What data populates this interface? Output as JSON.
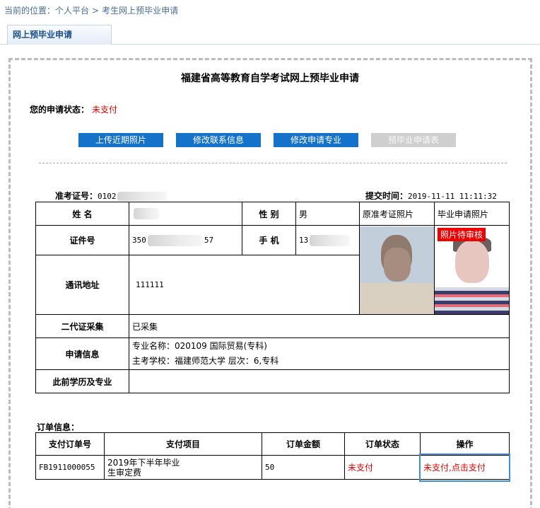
{
  "breadcrumb": {
    "prefix": "当前的位置：",
    "items": [
      "个人平台",
      "考生网上预毕业申请"
    ],
    "separator": ">"
  },
  "tab": {
    "label": "网上预毕业申请"
  },
  "page_title": "福建省高等教育自学考试网上预毕业申请",
  "status": {
    "label": "您的申请状态：",
    "value": "未支付"
  },
  "buttons": [
    {
      "label": "上传近期照片",
      "enabled": true
    },
    {
      "label": "修改联系信息",
      "enabled": true
    },
    {
      "label": "修改申请专业",
      "enabled": true
    },
    {
      "label": "预毕业申请表",
      "enabled": false
    }
  ],
  "meta": {
    "exam_no_label": "准考证号：",
    "exam_no_value": "0102",
    "submit_time_label": "提交时间：",
    "submit_time_value": "2019-11-11 11:11:32"
  },
  "info": {
    "name_label": "姓 名",
    "name_value": "",
    "gender_label": "性 别",
    "gender_value": "男",
    "orig_photo_label": "原准考证照片",
    "grad_photo_label": "毕业申请照片",
    "photo_pending": "照片待审核",
    "id_label": "证件号",
    "id_prefix": "350",
    "id_suffix": "57",
    "phone_label": "手 机",
    "phone_value": "13",
    "address_label": "通讯地址",
    "address_value": "111111",
    "idcard_label": "二代证采集",
    "idcard_value": "已采集",
    "apply_label": "申请信息",
    "apply_line1": "专业名称：020109 国际贸易(专科)",
    "apply_line2": "主考学校：福建师范大学 层次：6,专科",
    "prior_label": "此前学历及专业",
    "prior_value": ""
  },
  "orders": {
    "section_label": "订单信息：",
    "headers": [
      "支付订单号",
      "支付项目",
      "订单金额",
      "订单状态",
      "操作"
    ],
    "row": {
      "order_no": "FB1911000055",
      "item_line1": "2019年下半年毕业",
      "item_line2": "生审定费",
      "amount": "50",
      "status": "未支付",
      "action": "未支付,点击支付"
    }
  },
  "colors": {
    "button_blue": "#1572cb",
    "button_disabled": "#cfcfcf",
    "alert_red": "#e00000",
    "focus_blue": "#3a8fe0"
  }
}
